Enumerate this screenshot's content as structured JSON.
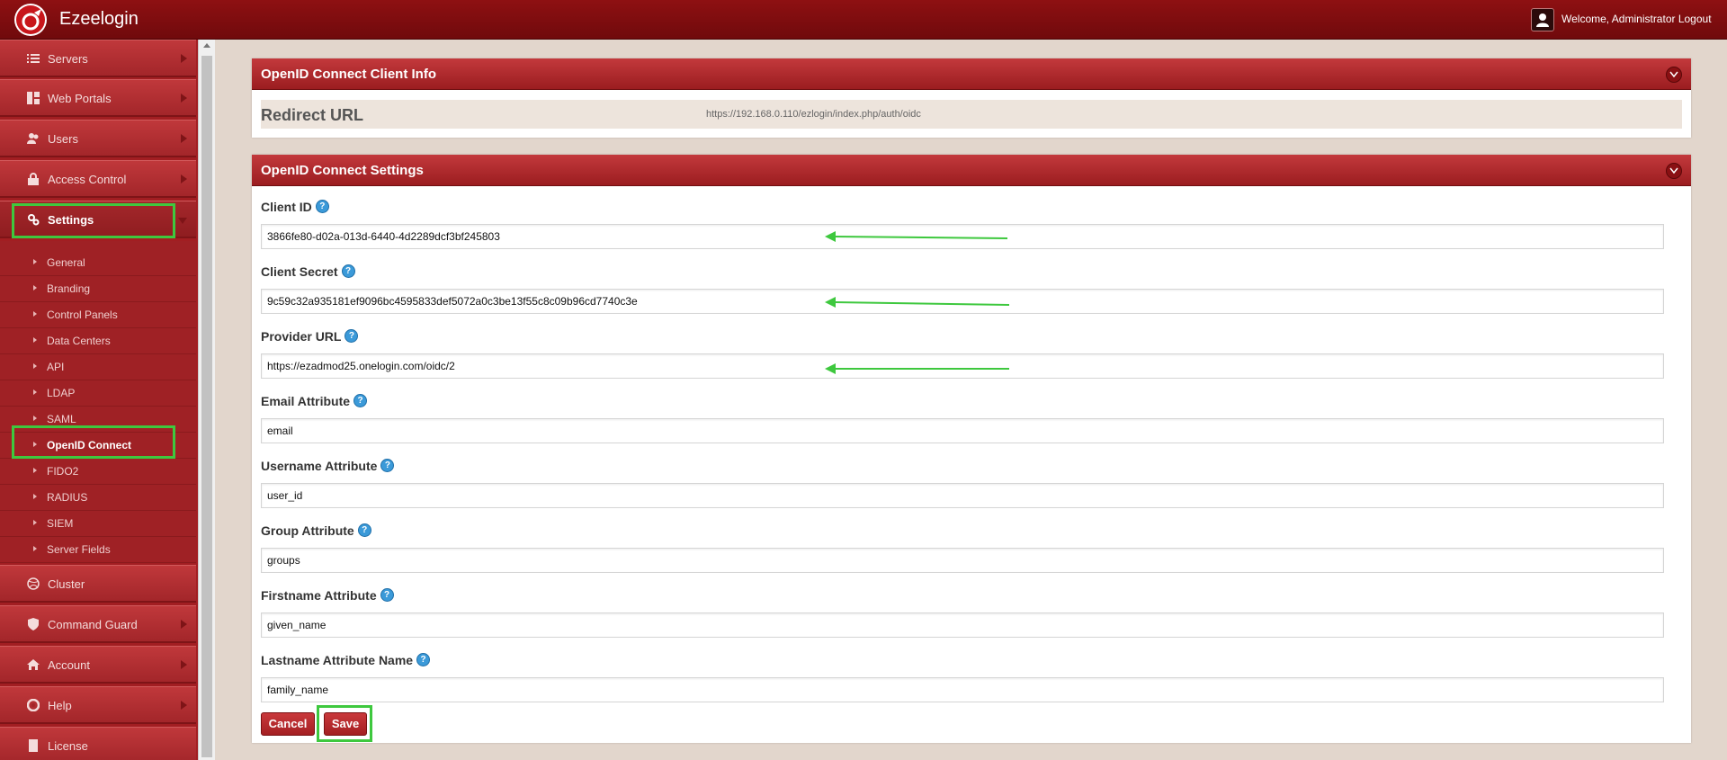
{
  "app": {
    "brand": "Ezeelogin",
    "welcome": "Welcome, Administrator Logout"
  },
  "sidebar": {
    "items": [
      {
        "label": "Servers",
        "icon": "list-icon"
      },
      {
        "label": "Web Portals",
        "icon": "dashboard-icon"
      },
      {
        "label": "Users",
        "icon": "users-icon"
      },
      {
        "label": "Access Control",
        "icon": "lock-icon"
      },
      {
        "label": "Settings",
        "icon": "gears-icon"
      },
      {
        "label": "Cluster",
        "icon": "dribbble-icon"
      },
      {
        "label": "Command Guard",
        "icon": "shield-icon"
      },
      {
        "label": "Account",
        "icon": "home-icon"
      },
      {
        "label": "Help",
        "icon": "lifebuoy-icon"
      },
      {
        "label": "License",
        "icon": "document-icon"
      }
    ],
    "settings_sub": [
      "General",
      "Branding",
      "Control Panels",
      "Data Centers",
      "API",
      "LDAP",
      "SAML",
      "OpenID Connect",
      "FIDO2",
      "RADIUS",
      "SIEM",
      "Server Fields"
    ],
    "active_sub": "OpenID Connect"
  },
  "client_info": {
    "title": "OpenID Connect Client Info",
    "redirect_label": "Redirect URL",
    "redirect_value": "https://192.168.0.110/ezlogin/index.php/auth/oidc"
  },
  "settings": {
    "title": "OpenID Connect Settings",
    "help": "?",
    "fields": [
      {
        "label": "Client ID",
        "value": "3866fe80-d02a-013d-6440-4d2289dcf3bf245803"
      },
      {
        "label": "Client Secret",
        "value": "9c59c32a935181ef9096bc4595833def5072a0c3be13f55c8c09b96cd7740c3e"
      },
      {
        "label": "Provider URL",
        "value": "https://ezadmod25.onelogin.com/oidc/2"
      },
      {
        "label": "Email Attribute",
        "value": "email"
      },
      {
        "label": "Username Attribute",
        "value": "user_id"
      },
      {
        "label": "Group Attribute",
        "value": "groups"
      },
      {
        "label": "Firstname Attribute",
        "value": "given_name"
      },
      {
        "label": "Lastname Attribute Name",
        "value": "family_name"
      }
    ],
    "cancel_label": "Cancel",
    "save_label": "Save"
  },
  "colors": {
    "accent": "#a3262a",
    "highlight": "#3ec83e",
    "topbar": "#7a0c0e"
  }
}
